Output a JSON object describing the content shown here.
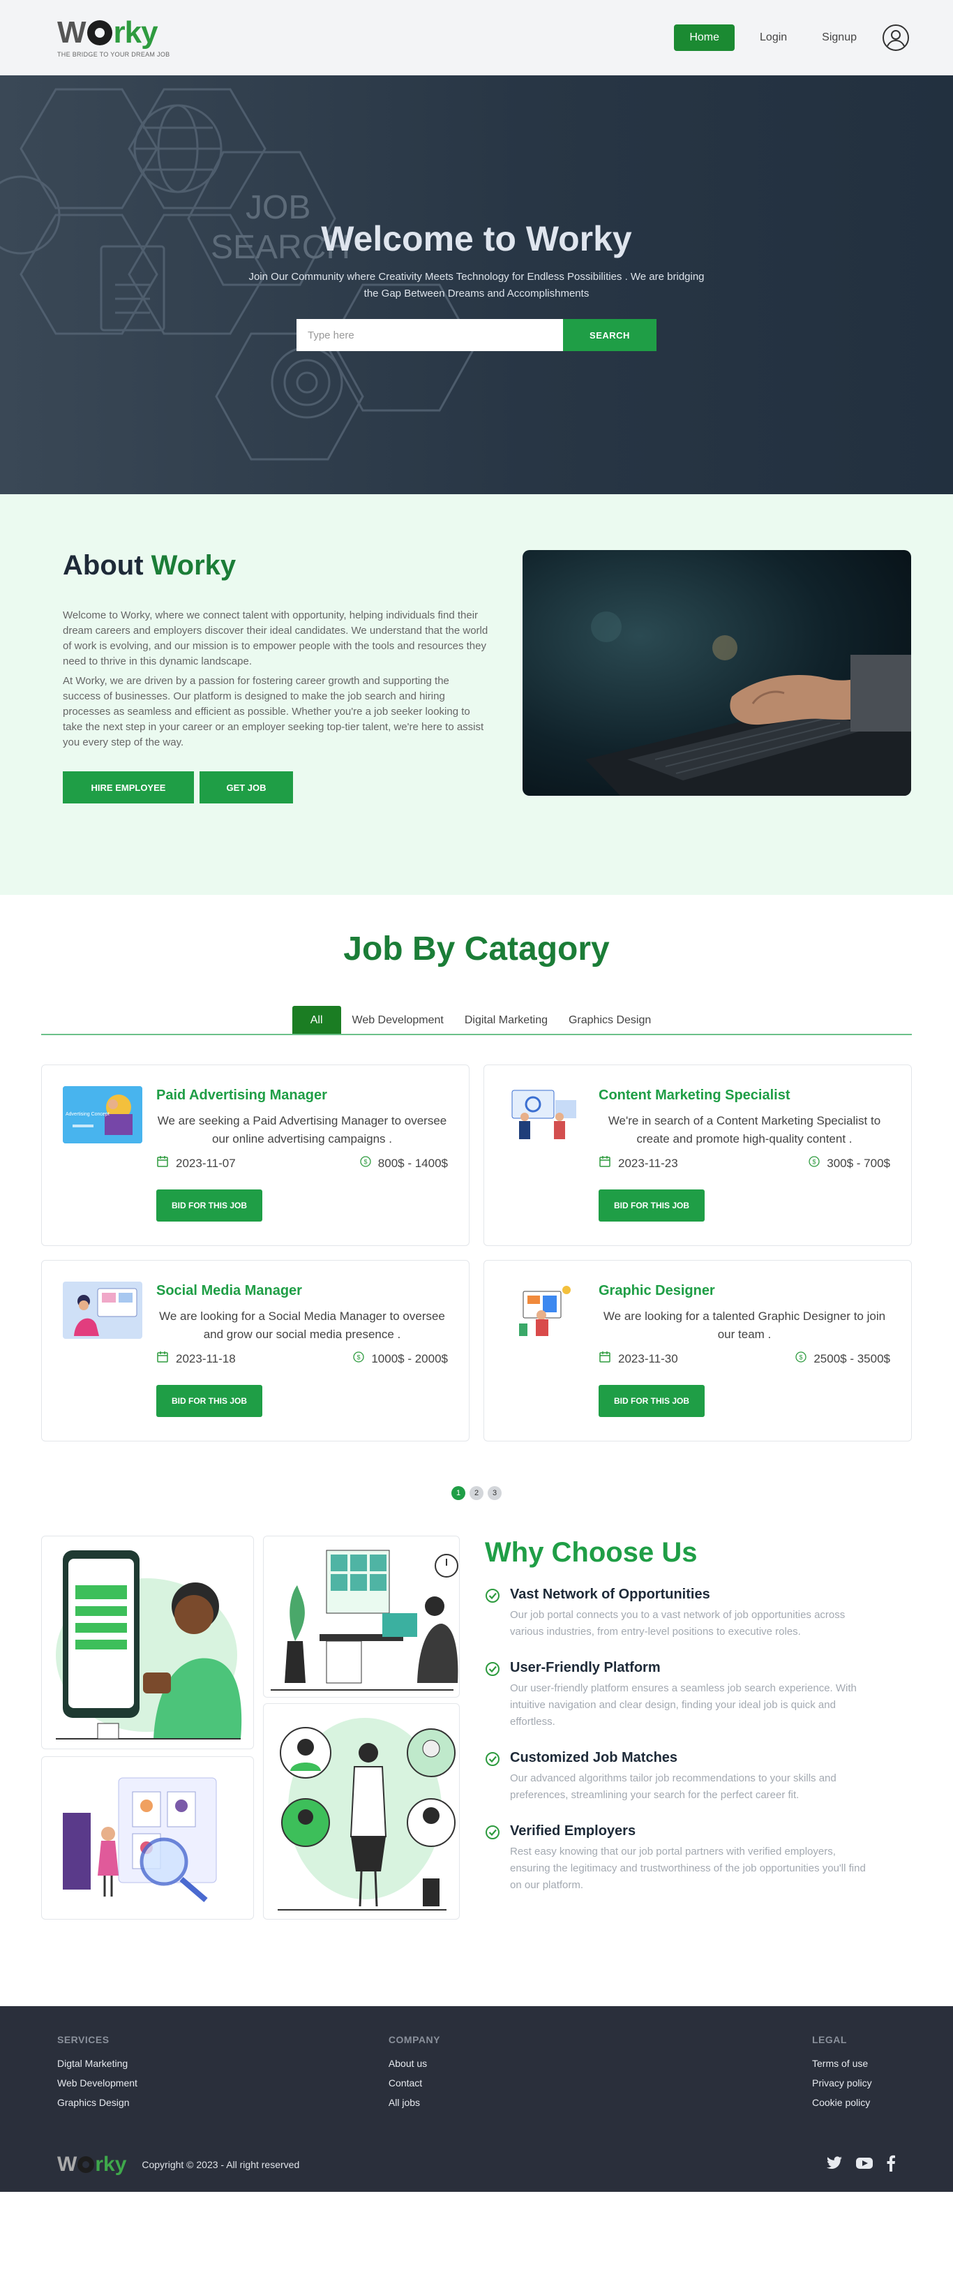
{
  "brand": {
    "name_w": "W",
    "name_o": "o",
    "name_rest": "rky",
    "tagline": "THE BRIDGE TO YOUR DREAM JOB"
  },
  "nav": {
    "home": "Home",
    "login": "Login",
    "signup": "Signup"
  },
  "hero": {
    "bg_text_1": "JOB",
    "bg_text_2": "SEARCH",
    "title": "Welcome to Worky",
    "subtitle": "Join Our Community where Creativity Meets Technology for Endless Possibilities . We are bridging the Gap Between Dreams and Accomplishments",
    "search_placeholder": "Type here",
    "search_button": "SEARCH"
  },
  "about": {
    "title_prefix": "About",
    "title_brand": "Worky",
    "p1": "Welcome to Worky, where we connect talent with opportunity, helping individuals find their dream careers and employers discover their ideal candidates. We understand that the world of work is evolving, and our mission is to empower people with the tools and resources they need to thrive in this dynamic landscape.",
    "p2": "At Worky, we are driven by a passion for fostering career growth and supporting the success of businesses. Our platform is designed to make the job search and hiring processes as seamless and efficient as possible. Whether you're a job seeker looking to take the next step in your career or an employer seeking top-tier talent, we're here to assist you every step of the way.",
    "hire_button": "HIRE EMPLOYEE",
    "get_job_button": "GET JOB"
  },
  "category": {
    "title": "Job By Catagory",
    "tabs": [
      "All",
      "Web Development",
      "Digital Marketing",
      "Graphics Design"
    ],
    "bid_label": "BID FOR THIS JOB",
    "jobs": [
      {
        "title": "Paid Advertising Manager",
        "desc": "We are seeking a Paid Advertising Manager to oversee our online advertising campaigns .",
        "date": "2023-11-07",
        "budget": "800$ - 1400$",
        "thumb_text": "Advertising Concept"
      },
      {
        "title": "Content Marketing Specialist",
        "desc": "We're in search of a Content Marketing Specialist to create and promote high-quality content .",
        "date": "2023-11-23",
        "budget": "300$ - 700$"
      },
      {
        "title": "Social Media Manager",
        "desc": "We are looking for a Social Media Manager to oversee and grow our social media presence .",
        "date": "2023-11-18",
        "budget": "1000$ - 2000$"
      },
      {
        "title": "Graphic Designer",
        "desc": "We are looking for a talented Graphic Designer to join our team .",
        "date": "2023-11-30",
        "budget": "2500$ - 3500$"
      }
    ],
    "pages": [
      "1",
      "2",
      "3"
    ]
  },
  "why": {
    "title": "Why Choose Us",
    "items": [
      {
        "title": "Vast Network of Opportunities",
        "text": "Our job portal connects you to a vast network of job opportunities across various industries, from entry-level positions to executive roles."
      },
      {
        "title": "User-Friendly Platform",
        "text": "Our user-friendly platform ensures a seamless job search experience. With intuitive navigation and clear design, finding your ideal job is quick and effortless."
      },
      {
        "title": "Customized Job Matches",
        "text": "Our advanced algorithms tailor job recommendations to your skills and preferences, streamlining your search for the perfect career fit."
      },
      {
        "title": "Verified Employers",
        "text": "Rest easy knowing that our job portal partners with verified employers, ensuring the legitimacy and trustworthiness of the job opportunities you'll find on our platform."
      }
    ]
  },
  "footer": {
    "services": {
      "heading": "SERVICES",
      "links": [
        "Digtal Marketing",
        "Web Development",
        "Graphics Design"
      ]
    },
    "company": {
      "heading": "COMPANY",
      "links": [
        "About us",
        "Contact",
        "All jobs"
      ]
    },
    "legal": {
      "heading": "LEGAL",
      "links": [
        "Terms of use",
        "Privacy policy",
        "Cookie policy"
      ]
    },
    "copyright": "Copyright © 2023 - All right reserved"
  },
  "colors": {
    "brand_green": "#1f9e46",
    "dark_green": "#1b7d37",
    "hero_bg": "#22303f",
    "footer_bg": "#2a2f3b",
    "about_bg": "#ebfaf0"
  },
  "icons": [
    "user-icon",
    "calendar-icon",
    "dollar-circle-icon",
    "check-circle-icon",
    "twitter-icon",
    "youtube-icon",
    "facebook-icon"
  ]
}
